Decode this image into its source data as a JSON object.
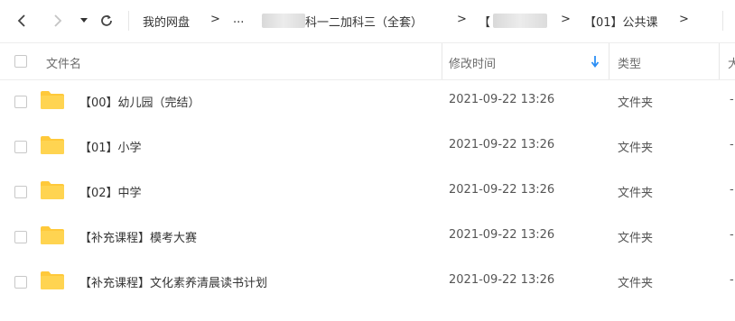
{
  "nav": {
    "back_icon": "chevron-left-icon",
    "forward_icon": "chevron-right-icon",
    "dropdown_icon": "caret-down-icon",
    "refresh_icon": "refresh-icon",
    "crumb_root": "我的网盘",
    "crumb_ellipsis": "...",
    "crumb_course_suffix": "科一二加科三（全套）",
    "crumb_third_prefix": "【",
    "crumb_current": "【01】公共课",
    "separator": ">"
  },
  "header": {
    "col_name": "文件名",
    "col_modified": "修改时间",
    "col_type": "类型",
    "col_size_partial": "大",
    "sort_icon": "arrow-down-icon",
    "accent": "#2b8ef5"
  },
  "rows": [
    {
      "name": "【00】幼儿园（完结）",
      "modified": "2021-09-22 13:26",
      "type": "文件夹",
      "size": "-"
    },
    {
      "name": "【01】小学",
      "modified": "2021-09-22 13:26",
      "type": "文件夹",
      "size": "-"
    },
    {
      "name": "【02】中学",
      "modified": "2021-09-22 13:26",
      "type": "文件夹",
      "size": "-"
    },
    {
      "name": "【补充课程】模考大赛",
      "modified": "2021-09-22 13:26",
      "type": "文件夹",
      "size": "-"
    },
    {
      "name": "【补充课程】文化素养清晨读书计划",
      "modified": "2021-09-22 13:26",
      "type": "文件夹",
      "size": "-"
    }
  ],
  "folder_color": "#ffc93a"
}
